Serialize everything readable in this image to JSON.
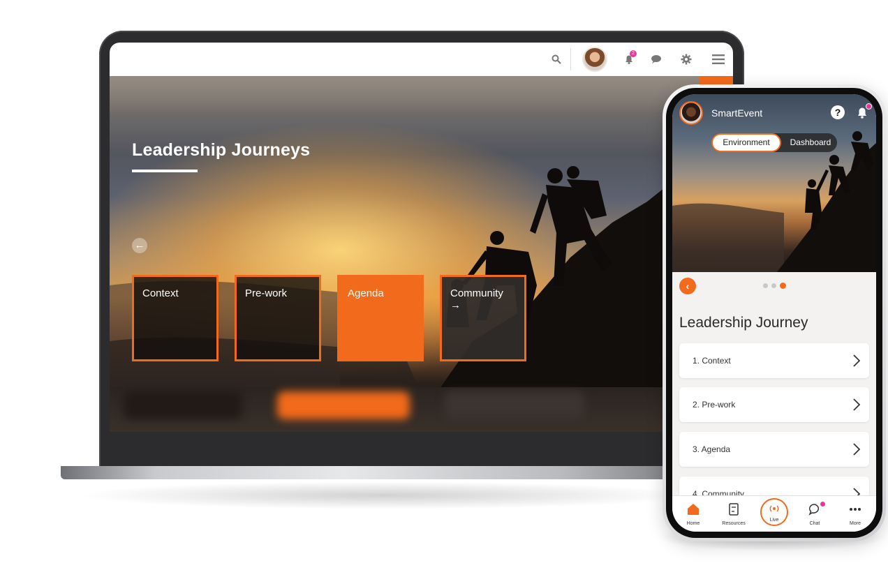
{
  "laptop": {
    "topbar": {
      "icons": [
        "search-icon",
        "avatar",
        "bell-icon",
        "chat-icon",
        "gear-icon",
        "menu-icon"
      ],
      "notification_count": "2"
    },
    "hero": {
      "title": "Leadership Journeys",
      "back_arrow": "←"
    },
    "tiles": [
      {
        "label": "Context",
        "state": "outlined"
      },
      {
        "label": "Pre-work",
        "state": "outlined"
      },
      {
        "label": "Agenda",
        "state": "active"
      },
      {
        "label": "Community",
        "arrow": "→",
        "state": "outlined"
      }
    ]
  },
  "phone": {
    "app_name": "SmartEvent",
    "help_icon_text": "?",
    "segments": {
      "environment": "Environment",
      "dashboard": "Dashboard",
      "selected": "Environment"
    },
    "carousel": {
      "pages": 3,
      "current": 3
    },
    "section_title": "Leadership Journey",
    "items": [
      {
        "label": "1. Context"
      },
      {
        "label": "2. Pre-work"
      },
      {
        "label": "3. Agenda"
      },
      {
        "label": "4. Community"
      }
    ],
    "tabbar": [
      {
        "label": "Home",
        "icon": "home-icon"
      },
      {
        "label": "Resources",
        "icon": "book-icon"
      },
      {
        "label": "Live",
        "icon": "broadcast-icon"
      },
      {
        "label": "Chat",
        "icon": "chat-bubble-icon"
      },
      {
        "label": "More",
        "icon": "more-dots-icon"
      }
    ]
  },
  "colors": {
    "accent": "#f26a1b",
    "notification": "#e8399a",
    "card_background": "#ffffff",
    "phone_background": "#f3f2f0"
  }
}
